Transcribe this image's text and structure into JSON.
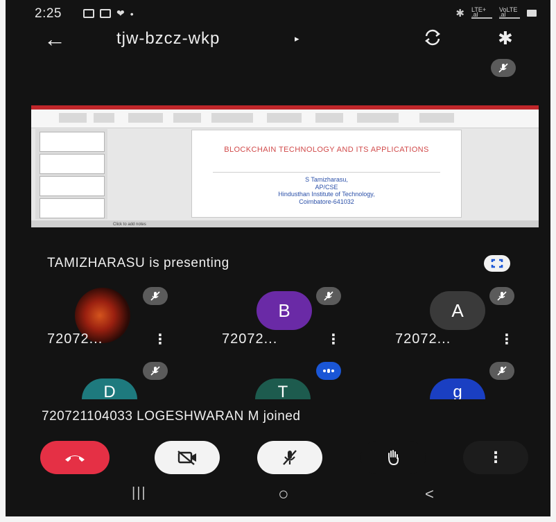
{
  "status_bar": {
    "time": "2:25",
    "right_text_1": "LTE+ .al",
    "right_text_2": "VoLTE .al"
  },
  "header": {
    "meeting_code": "tjw-bzcz-wkp",
    "caret": "▸",
    "back_icon": "back-arrow-icon",
    "camera_switch_icon": "camera-switch-icon",
    "bluetooth_icon": "bluetooth-icon"
  },
  "presentation": {
    "slide_title": "BLOCKCHAIN TECHNOLOGY AND ITS APPLICATIONS",
    "author_lines": [
      "S Tamizharasu,",
      "AP/CSE",
      "Hindusthan Institute of Technology,",
      "Coimbatore-641032"
    ],
    "status_text": "Click to add notes"
  },
  "presenting_text": "TAMIZHARASU is presenting",
  "participants": [
    {
      "initial": "",
      "name": "72072...",
      "color": "#8a2515",
      "muted": true
    },
    {
      "initial": "B",
      "name": "72072...",
      "color": "#6a2aa6",
      "muted": true
    },
    {
      "initial": "A",
      "name": "72072...",
      "color": "#3a3a3a",
      "muted": true
    },
    {
      "initial": "D",
      "name": "",
      "color": "#1e7a7e",
      "muted": true
    },
    {
      "initial": "T",
      "name": "",
      "color": "#1d5b4e",
      "muted": false
    },
    {
      "initial": "g",
      "name": "",
      "color": "#1a3fc2",
      "muted": true
    }
  ],
  "toast": "720721104033 LOGESHWARAN M joined",
  "controls": {
    "end_call_icon": "end-call-icon",
    "camera_off_icon": "camera-off-icon",
    "mic_off_icon": "mic-off-icon",
    "raise_hand_icon": "raise-hand-icon",
    "more_icon": "more-vert-icon"
  },
  "nav": {
    "recents": "|||",
    "home": "○",
    "back": "<"
  },
  "colors": {
    "background": "#131313",
    "end_call": "#e53045",
    "speaking_badge": "#1a56d6",
    "mute_badge": "#5b5b5b"
  }
}
